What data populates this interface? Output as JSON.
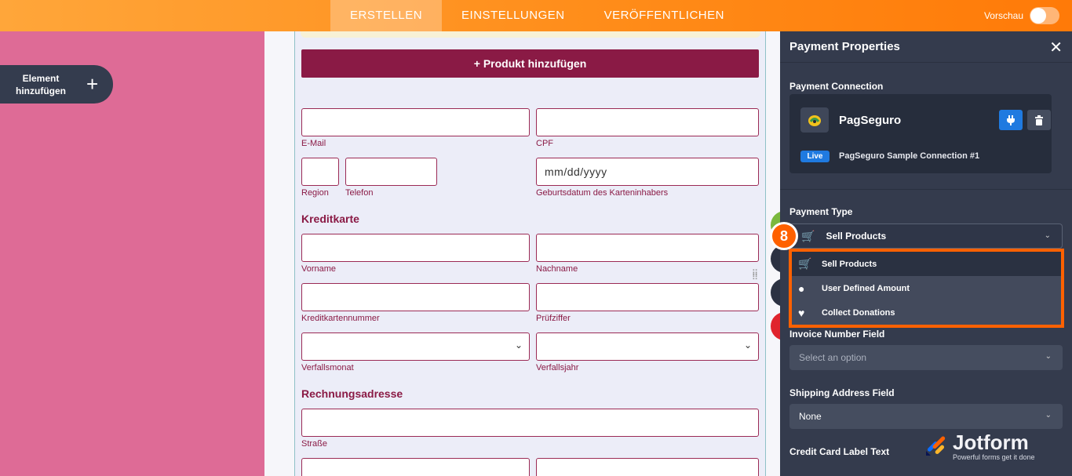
{
  "topbar": {
    "tabs": [
      {
        "label": "ERSTELLEN",
        "active": true
      },
      {
        "label": "EINSTELLUNGEN",
        "active": false
      },
      {
        "label": "VERÖFFENTLICHEN",
        "active": false
      }
    ],
    "preview_label": "Vorschau",
    "preview_on": false
  },
  "sidebar": {
    "add_element_line1": "Element",
    "add_element_line2": "hinzufügen"
  },
  "form": {
    "add_product_label": "+ Produkt hinzufügen",
    "email_label": "E-Mail",
    "cpf_label": "CPF",
    "region_label": "Region",
    "phone_label": "Telefon",
    "birthdate_value": "mm/dd/yyyy",
    "birthdate_label": "Geburtsdatum des Karteninhabers",
    "section_card": "Kreditkarte",
    "firstname_label": "Vorname",
    "lastname_label": "Nachname",
    "cardnumber_label": "Kreditkartennummer",
    "cvv_label": "Prüfziffer",
    "exp_month_label": "Verfallsmonat",
    "exp_year_label": "Verfallsjahr",
    "section_billing": "Rechnungsadresse",
    "street_label": "Straße"
  },
  "panel": {
    "title": "Payment Properties",
    "connection_label": "Payment Connection",
    "gateway_name": "PagSeguro",
    "live_badge": "Live",
    "connection_name": "PagSeguro Sample Connection #1",
    "payment_type_label": "Payment Type",
    "payment_type_value": "Sell Products",
    "payment_type_options": [
      {
        "label": "Sell Products",
        "icon": "cart-icon",
        "selected": true
      },
      {
        "label": "User Defined Amount",
        "icon": "coins-icon",
        "selected": false
      },
      {
        "label": "Collect Donations",
        "icon": "heart-icon",
        "selected": false
      }
    ],
    "invoice_label": "Invoice Number Field",
    "invoice_placeholder": "Select an option",
    "shipping_label": "Shipping Address Field",
    "shipping_value": "None",
    "cc_label_text": "Credit Card Label Text"
  },
  "annotation": {
    "step_number": "8",
    "highlight_color": "#ff6100"
  },
  "brand": {
    "logo_text": "Jotform",
    "tagline": "Powerful forms get it done"
  },
  "colors": {
    "accent_orange": "#ff8d1a",
    "form_maroon": "#8a1a45",
    "panel_bg": "#343b4d",
    "left_pink": "#de6b96"
  }
}
